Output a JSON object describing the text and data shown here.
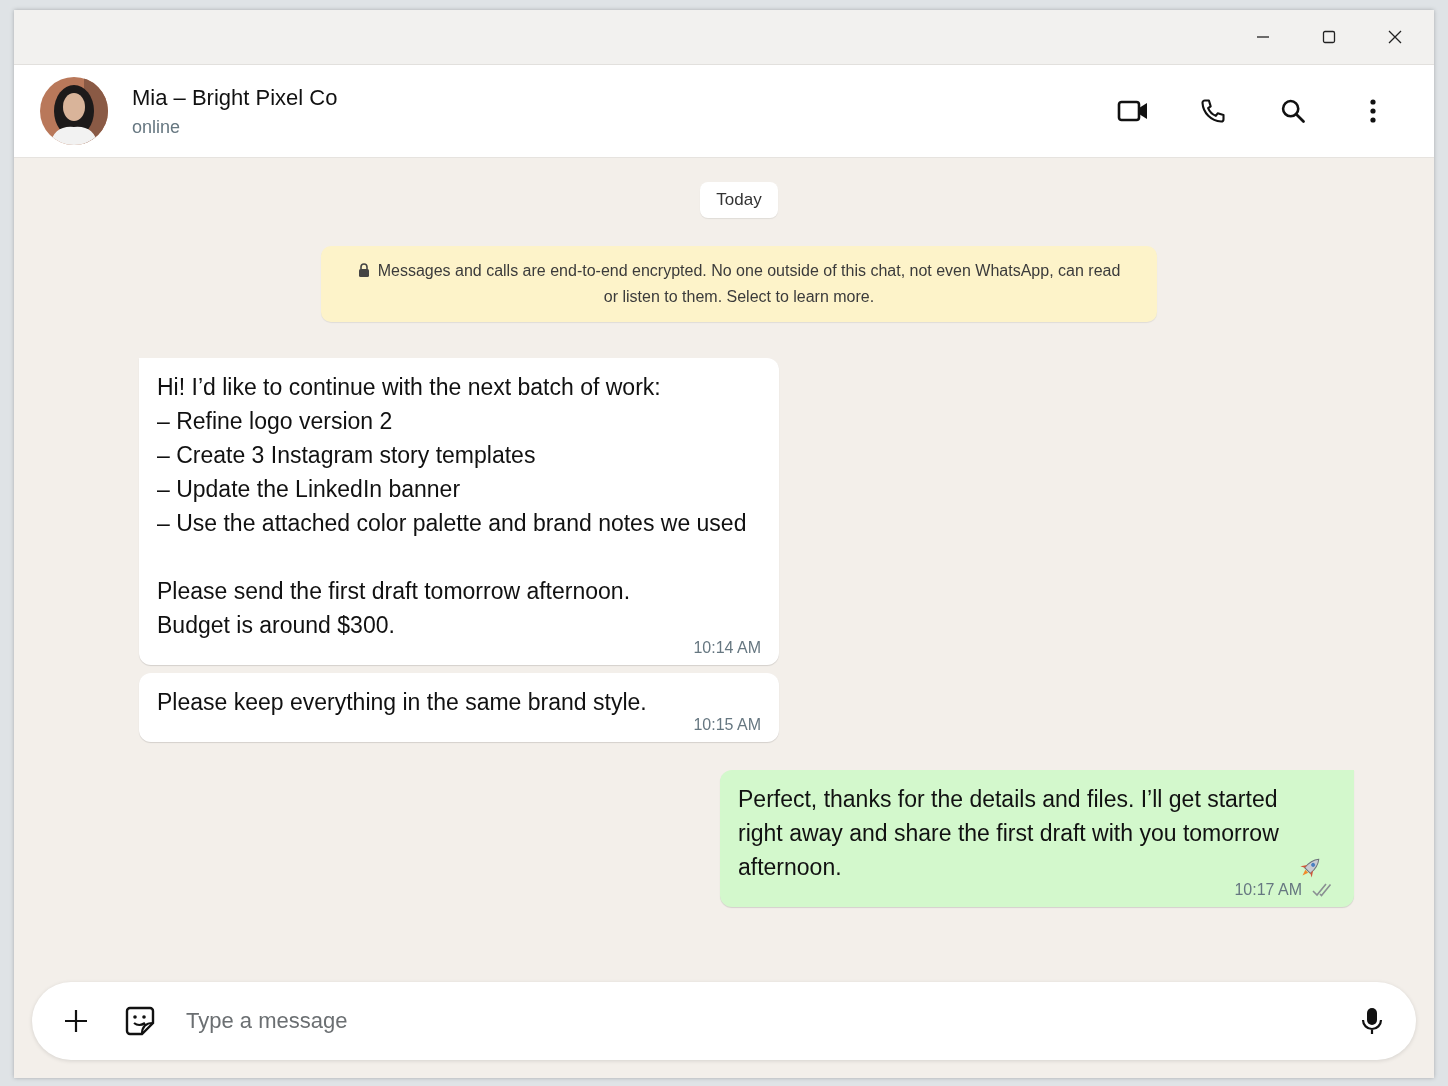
{
  "window": {
    "controls": [
      {
        "kind": "minimize"
      },
      {
        "kind": "maximize"
      },
      {
        "kind": "close"
      }
    ]
  },
  "contact": {
    "name": "Mia – Bright Pixel Co",
    "status": "online"
  },
  "header_actions": [
    {
      "kind": "video"
    },
    {
      "kind": "call"
    },
    {
      "kind": "search"
    },
    {
      "kind": "menu"
    }
  ],
  "date_chip": "Today",
  "encryption_notice": "Messages and calls are end-to-end encrypted. No one outside of this chat, not even WhatsApp, can read or listen to them. Select to learn more.",
  "messages": [
    {
      "kind": "incoming",
      "text": "Hi! I’d like to continue with the next batch of work:\n– Refine logo version 2\n– Create 3 Instagram story templates\n– Update the LinkedIn banner\n– Use the attached color palette and brand notes we used\n\nPlease send the first draft tomorrow afternoon.\nBudget is around $300.",
      "time": "10:14 AM",
      "tail": true
    },
    {
      "kind": "incoming",
      "text": "Please keep everything in the same brand style.",
      "time": "10:15 AM",
      "tail": false
    },
    {
      "kind": "outgoing",
      "text": "Perfect, thanks for the details and files. I’ll get started right away and share the first draft with you tomorrow afternoon.",
      "emoji": {
        "kind": "rocket"
      },
      "time": "10:17 AM",
      "tail": true,
      "ticks": {
        "kind": "double",
        "read": false
      }
    }
  ],
  "composer": {
    "placeholder": "Type a message"
  }
}
